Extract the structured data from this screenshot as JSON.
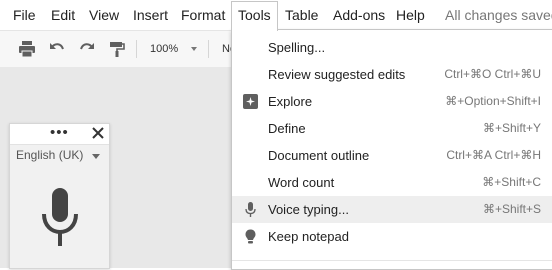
{
  "menubar": {
    "items": [
      "File",
      "Edit",
      "View",
      "Insert",
      "Format",
      "Tools",
      "Table",
      "Add-ons",
      "Help"
    ],
    "status": "All changes saved"
  },
  "toolbar": {
    "zoom": "100%",
    "font_partial": "No"
  },
  "voice_panel": {
    "language": "English (UK)",
    "more_icon": "more-dots-icon",
    "close_icon": "close-icon",
    "mic_icon": "microphone-icon"
  },
  "tools_menu": {
    "items": [
      {
        "label": "Spelling...",
        "shortcut": "",
        "icon": ""
      },
      {
        "label": "Review suggested edits",
        "shortcut": "Ctrl+⌘O Ctrl+⌘U",
        "icon": ""
      },
      {
        "label": "Explore",
        "shortcut": "⌘+Option+Shift+I",
        "icon": "explore-icon"
      },
      {
        "label": "Define",
        "shortcut": "⌘+Shift+Y",
        "icon": ""
      },
      {
        "label": "Document outline",
        "shortcut": "Ctrl+⌘A Ctrl+⌘H",
        "icon": ""
      },
      {
        "label": "Word count",
        "shortcut": "⌘+Shift+C",
        "icon": ""
      },
      {
        "label": "Voice typing...",
        "shortcut": "⌘+Shift+S",
        "icon": "microphone-icon",
        "highlighted": true
      },
      {
        "label": "Keep notepad",
        "shortcut": "",
        "icon": "lightbulb-icon"
      }
    ]
  },
  "colors": {
    "menu_highlight": "#eeeeee",
    "canvas": "#e8e8e8",
    "toolbar": "#f7f7f7",
    "icon": "#5f5f5f"
  }
}
